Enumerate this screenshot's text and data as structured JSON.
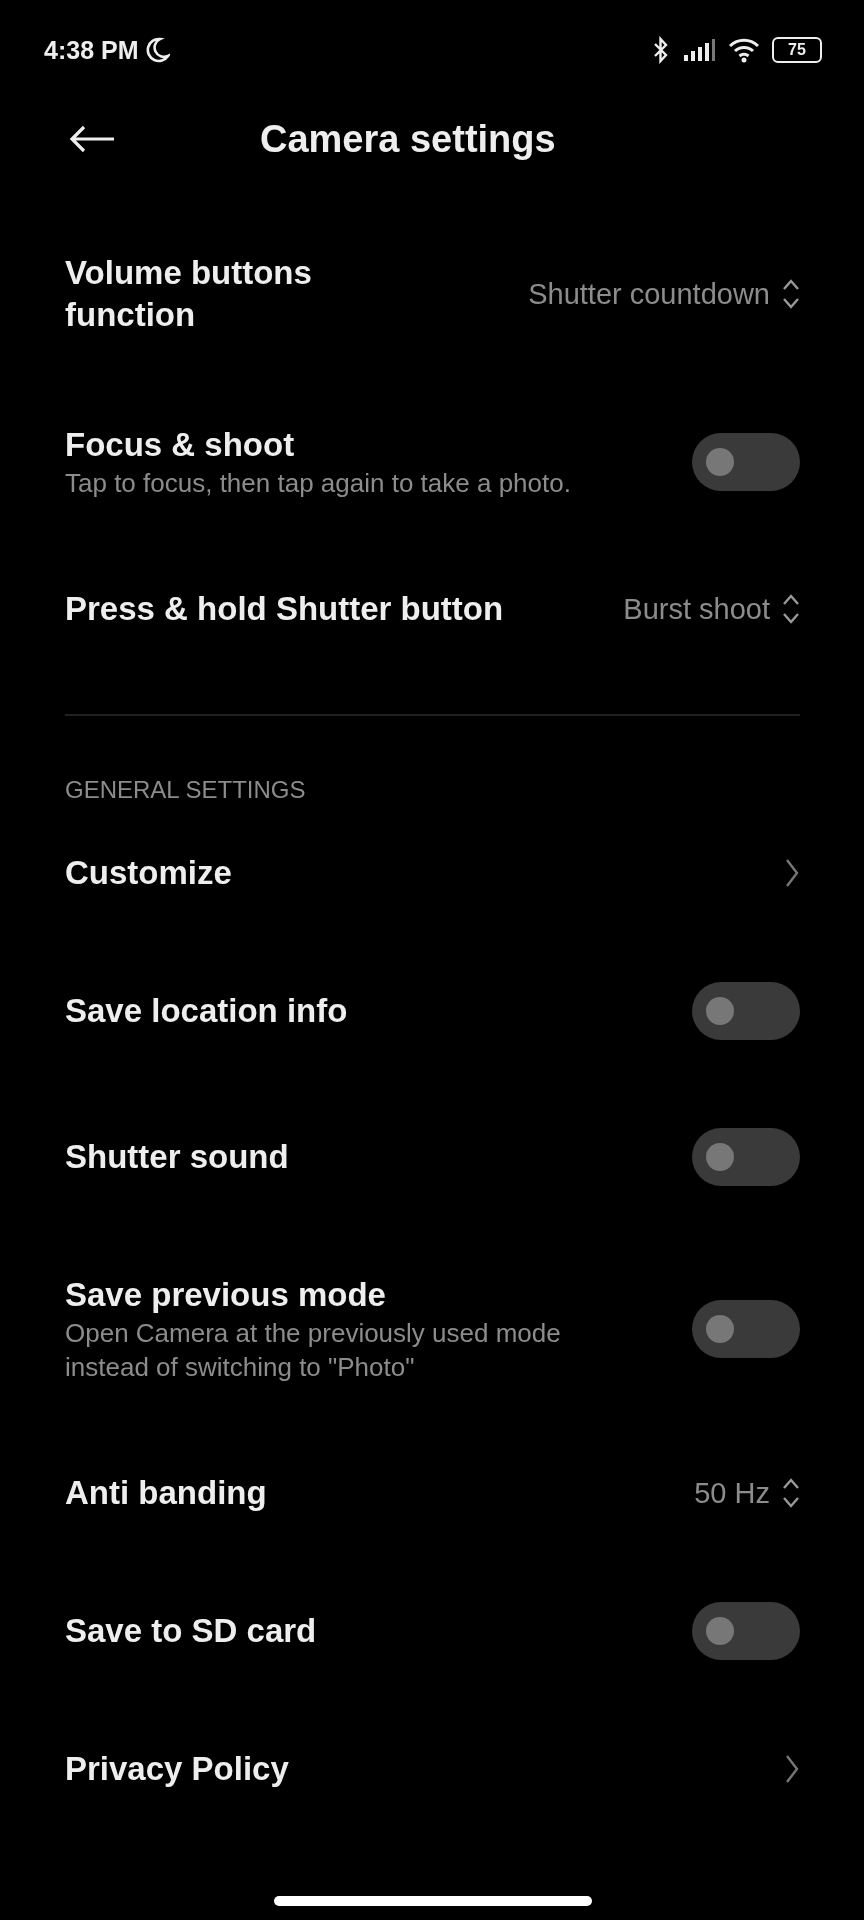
{
  "status_bar": {
    "time": "4:38 PM",
    "battery": "75"
  },
  "header": {
    "title": "Camera settings"
  },
  "items": [
    {
      "kind": "select",
      "label": "Volume buttons function",
      "value": "Shutter countdown"
    },
    {
      "kind": "toggle",
      "label": "Focus & shoot",
      "description": "Tap to focus, then tap again to take a photo.",
      "on": false
    },
    {
      "kind": "select",
      "label": "Press & hold Shutter button",
      "value": "Burst shoot"
    }
  ],
  "sections": [
    {
      "header": "GENERAL SETTINGS",
      "items": [
        {
          "kind": "link",
          "label": "Customize"
        },
        {
          "kind": "toggle",
          "label": "Save location info",
          "on": false
        },
        {
          "kind": "toggle",
          "label": "Shutter sound",
          "on": false
        },
        {
          "kind": "toggle",
          "label": "Save previous mode",
          "description": "Open Camera at the previously used mode instead of switching to \"Photo\"",
          "on": false
        },
        {
          "kind": "select",
          "label": "Anti banding",
          "value": "50 Hz"
        },
        {
          "kind": "toggle",
          "label": "Save to SD card",
          "on": false
        },
        {
          "kind": "link",
          "label": "Privacy Policy"
        }
      ]
    }
  ]
}
